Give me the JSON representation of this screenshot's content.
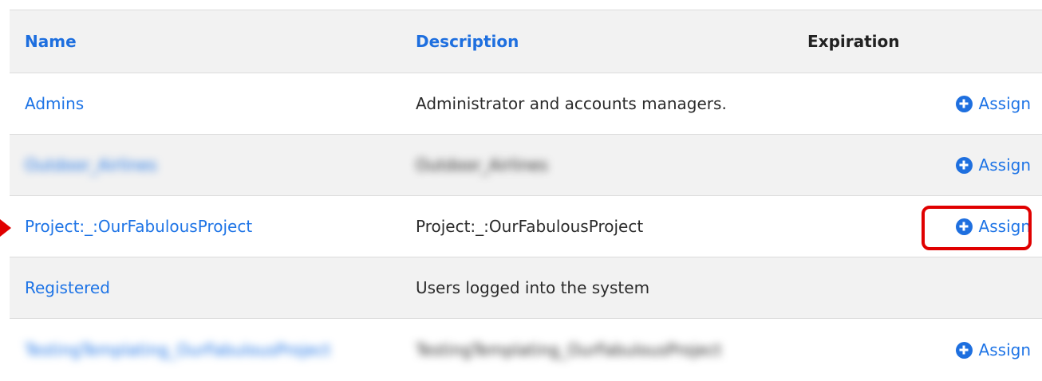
{
  "table": {
    "columns": {
      "name": "Name",
      "description": "Description",
      "expiration": "Expiration"
    },
    "rows": [
      {
        "name": "Admins",
        "description": "Administrator and accounts managers.",
        "action": "Assign"
      },
      {
        "name": "Outdoor_Airlines",
        "description": "Outdoor_Airlines",
        "action": "Assign"
      },
      {
        "name": "Project:_:OurFabulousProject",
        "description": "Project:_:OurFabulousProject",
        "action": "Assign"
      },
      {
        "name": "Registered",
        "description": "Users logged into the system",
        "action": ""
      },
      {
        "name": "TestingTemplating_OurFabulousProject",
        "description": "TestingTemplating_OurFabulousProject",
        "action": "Assign"
      }
    ]
  },
  "annotations": {
    "highlight_color": "#e00000"
  },
  "colors": {
    "link": "#1e74e6",
    "row_shade": "#f2f2f2"
  }
}
